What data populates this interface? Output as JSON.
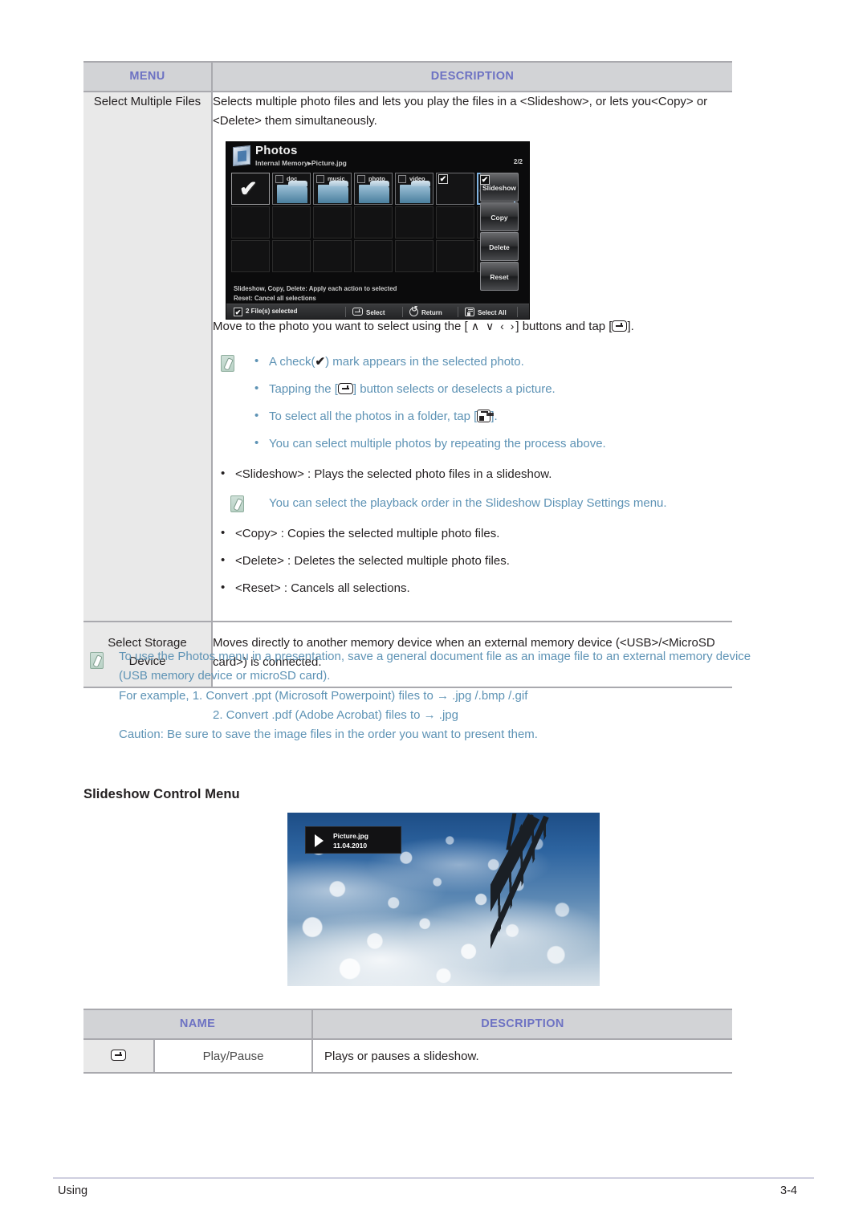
{
  "tables": {
    "menu_table": {
      "headers": {
        "menu": "MENU",
        "description": "DESCRIPTION"
      },
      "rows": [
        {
          "menu": "Select Multiple Files",
          "intro": "Selects multiple photo files and lets you play the files in a <Slideshow>, or lets you<Copy> or <Delete> them simultaneously.",
          "move_line_pre": "Move to the photo you want to select using the [",
          "move_line_keys": "∧ ∨ ‹ ›",
          "move_line_mid": "] buttons and tap [",
          "move_line_post": "].",
          "note_bullets": [
            {
              "pre": "A check(",
              "glyph": "✔",
              "post": ") mark appears in the selected photo."
            },
            {
              "pre": "Tapping the [",
              "icon": "enter-key-icon",
              "post": "] button selects or deselects a picture."
            },
            {
              "pre": "To select all the photos in a folder, tap [",
              "icon": "select-all-key-icon",
              "post": "]."
            },
            {
              "pre": "You can select multiple photos by repeating the process above.",
              "icon": "",
              "post": ""
            }
          ],
          "action_bullets": [
            "<Slideshow> : Plays the selected photo files in a slideshow.",
            "<Copy> : Copies the selected multiple photo files.",
            "<Delete> : Deletes the selected multiple photo files.",
            "<Reset> : Cancels all selections."
          ],
          "inline_note": "You can select the playback order in the Slideshow Display Settings menu."
        },
        {
          "menu_line1": "Select Storage",
          "menu_line2": "Device",
          "description": "Moves directly to another memory device when an external memory device (<USB>/<MicroSD card>) is connected."
        }
      ]
    },
    "name_table": {
      "headers": {
        "name": "NAME",
        "description": "DESCRIPTION"
      },
      "rows": [
        {
          "icon": "enter-key-icon",
          "name": "Play/Pause",
          "description": "Plays or pauses a slideshow."
        }
      ]
    }
  },
  "caution_note": {
    "line1": "To use the Photos menu in a presentation, save a general document file as an image file to an external memory device",
    "line2": "(USB memory device or microSD card).",
    "line3": "For example, 1. Convert .ppt (Microsoft Powerpoint) files to → .jpg /.bmp /.gif",
    "line4": "2. Convert .pdf (Adobe Acrobat) files to → .jpg",
    "line5": "Caution: Be sure to save the image files in the order you want to present them."
  },
  "section_heading": "Slideshow Control Menu",
  "device_screen": {
    "title": "Photos",
    "path": "Internal Memory▸Picture.jpg",
    "page_indicator": "2/2",
    "grid_items": [
      {
        "type": "select-all-tile",
        "label": ""
      },
      {
        "type": "folder",
        "label": "doc"
      },
      {
        "type": "folder",
        "label": "music"
      },
      {
        "type": "folder",
        "label": "photo"
      },
      {
        "type": "folder",
        "label": "video"
      },
      {
        "type": "photo-selected",
        "label": ""
      },
      {
        "type": "photo-selected-focused",
        "label": ""
      }
    ],
    "side_buttons": [
      "Slideshow",
      "Copy",
      "Delete",
      "Reset"
    ],
    "hint_line1": "Slideshow, Copy, Delete: Apply each action to selected",
    "hint_line2": "Reset: Cancel all selections",
    "status_bar": {
      "selected_count": "2 File(s) selected",
      "select": "Select",
      "return": "Return",
      "select_all": "Select All"
    }
  },
  "slideshow_osd": {
    "file_name": "Picture.jpg",
    "date": "11.04.2010"
  },
  "footer": {
    "left": "Using",
    "right": "3-4"
  },
  "colors": {
    "header_text": "#6d72c3",
    "header_bg": "#d2d3d6",
    "note_text": "#5e93b5",
    "menu_cell_bg": "#e9e9e9",
    "rule": "#a9a9ae"
  }
}
